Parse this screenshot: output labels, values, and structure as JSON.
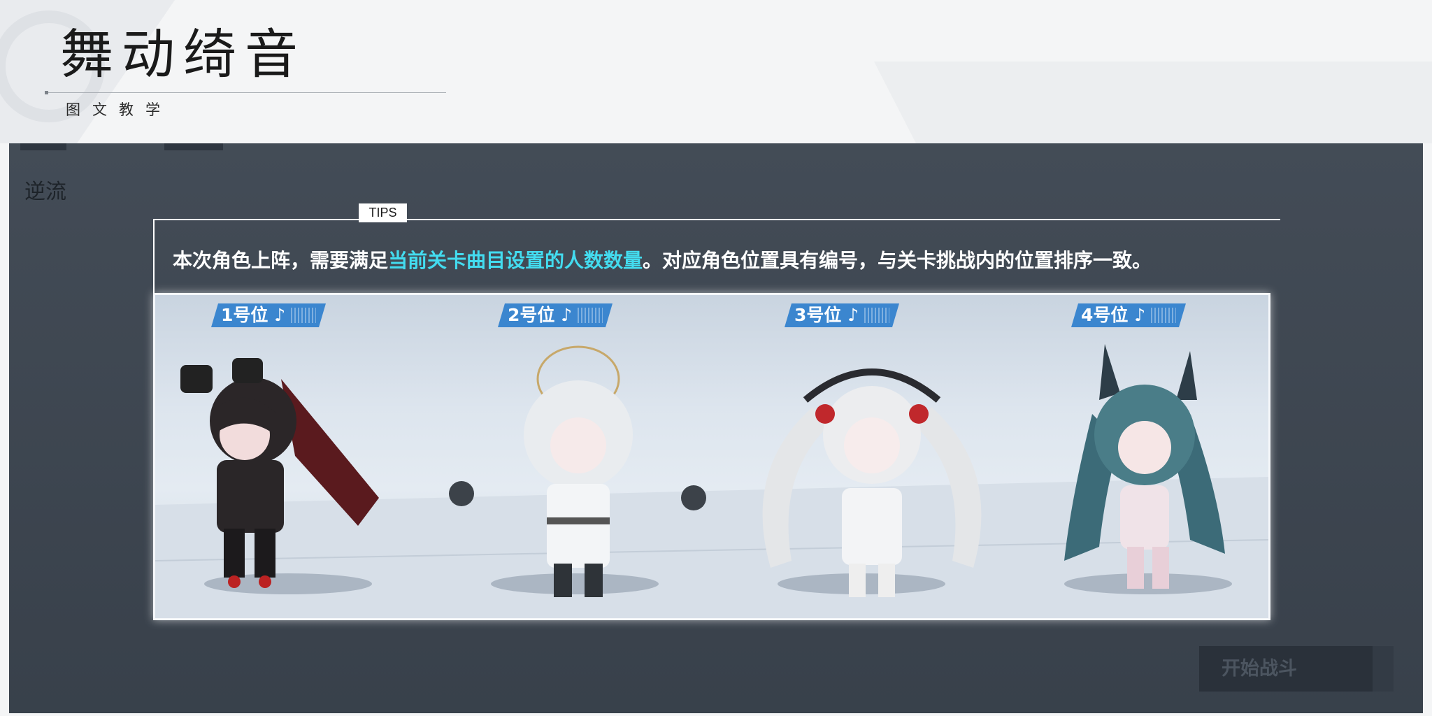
{
  "header": {
    "title": "舞动绮音",
    "subtitle": "图文教学"
  },
  "panel": {
    "stage_label": "逆流",
    "start_button": "开始战斗"
  },
  "tips": {
    "badge": "TIPS",
    "text_before": "本次角色上阵，需要满足",
    "text_highlight": "当前关卡曲目设置的人数数量",
    "text_after": "。对应角色位置具有编号，与关卡挑战内的位置排序一致。",
    "highlight_color": "#43dcef"
  },
  "positions": [
    {
      "label": "1号位",
      "note_icon": "music-note-icon",
      "character": "character-1"
    },
    {
      "label": "2号位",
      "note_icon": "music-note-icon",
      "character": "character-2"
    },
    {
      "label": "3号位",
      "note_icon": "music-note-icon",
      "character": "character-3"
    },
    {
      "label": "4号位",
      "note_icon": "music-note-icon",
      "character": "character-4"
    }
  ],
  "colors": {
    "panel_bg": "#3d4651",
    "label_bg": "#3b86cf"
  }
}
